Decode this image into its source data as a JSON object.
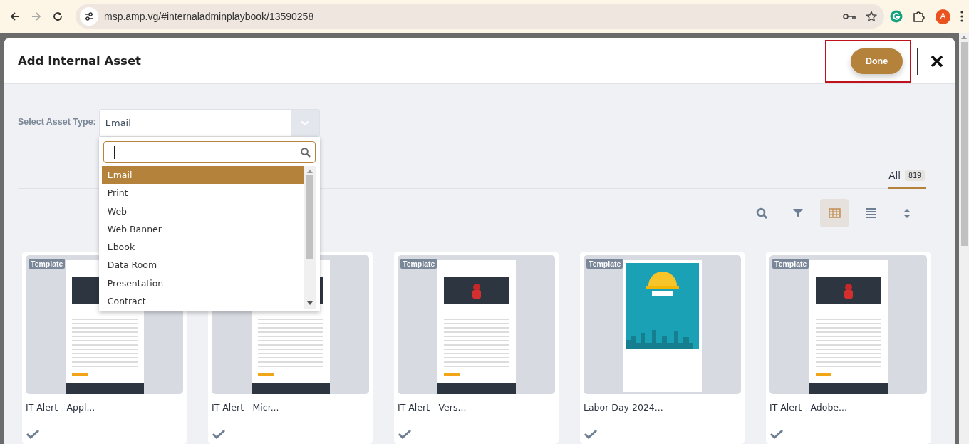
{
  "browser": {
    "url": "msp.amp.vg/#internaladminplaybook/13590258",
    "profile_initial": "A"
  },
  "modal": {
    "title": "Add Internal Asset",
    "done_button": {
      "label": "Done",
      "highlighted": true
    }
  },
  "asset_type": {
    "label": "Select Asset Type:",
    "value": "Email",
    "expanded": true,
    "options": [
      {
        "label": "Email",
        "selected": true
      },
      {
        "label": "Print",
        "selected": false
      },
      {
        "label": "Web",
        "selected": false
      },
      {
        "label": "Web Banner",
        "selected": false
      },
      {
        "label": "Ebook",
        "selected": false
      },
      {
        "label": "Data Room",
        "selected": false
      },
      {
        "label": "Presentation",
        "selected": false
      },
      {
        "label": "Contract",
        "selected": false
      }
    ]
  },
  "tabs": [
    {
      "label": "All",
      "count": "819",
      "selected": true
    }
  ],
  "view_buttons": [
    {
      "kind": "search",
      "selected": false
    },
    {
      "kind": "filter",
      "selected": false
    },
    {
      "kind": "grid",
      "selected": true
    },
    {
      "kind": "list",
      "selected": false
    },
    {
      "kind": "sort",
      "selected": false
    }
  ],
  "cards": [
    {
      "badge": "Template",
      "title": "IT Alert - Appl...",
      "kind": "email"
    },
    {
      "title": "IT Alert - Micr...",
      "kind": "email"
    },
    {
      "badge": "Template",
      "title": "IT Alert - Vers...",
      "kind": "email"
    },
    {
      "badge": "Template",
      "title": "Labor Day 2024...",
      "kind": "banner"
    },
    {
      "badge": "Template",
      "title": "IT Alert - Adobe...",
      "kind": "email"
    }
  ]
}
